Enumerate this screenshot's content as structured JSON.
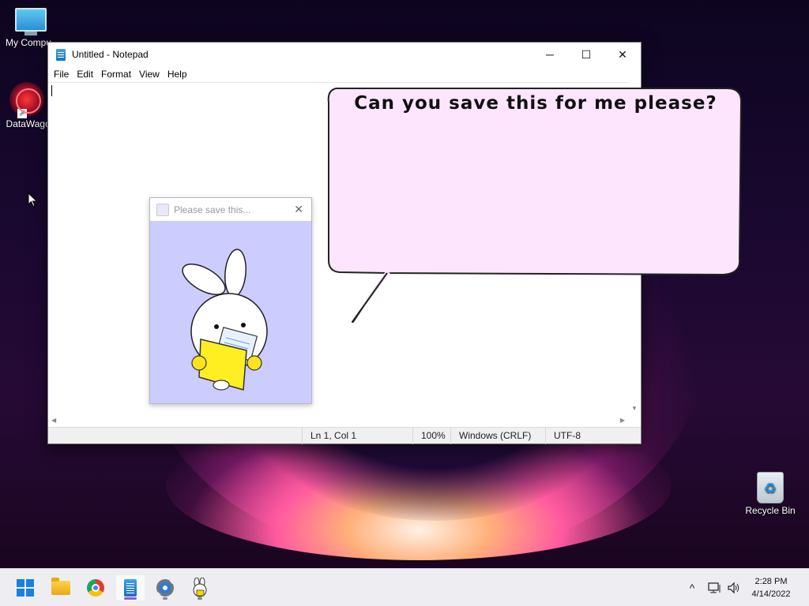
{
  "desktop": {
    "icons": [
      {
        "label": "My Compu",
        "icon": "monitor-icon"
      },
      {
        "label": "DataWagon",
        "icon": "datawagon-icon"
      },
      {
        "label": "Recycle Bin",
        "icon": "recycle-bin-icon"
      }
    ]
  },
  "notepad": {
    "title": "Untitled - Notepad",
    "controls": {
      "minimize": "─",
      "maximize": "☐",
      "close": "✕"
    },
    "menu": [
      "File",
      "Edit",
      "Format",
      "View",
      "Help"
    ],
    "content": "",
    "status": {
      "position": "Ln 1, Col 1",
      "zoom": "100%",
      "line_endings": "Windows (CRLF)",
      "encoding": "UTF-8"
    }
  },
  "popup": {
    "title": "Please save this...",
    "close": "✕",
    "background": "#ccccff",
    "illustration": "bunny-holding-folder"
  },
  "bubble": {
    "text": "Can you save this for me please?",
    "fill": "#fde6fd"
  },
  "taskbar": {
    "apps": [
      "start-button",
      "file-explorer-icon",
      "chrome-icon",
      "notepad-icon",
      "settings-icon",
      "bunny-app-icon"
    ],
    "active_app": "notepad-icon",
    "tray": {
      "chevron": "^"
    },
    "clock": {
      "time": "2:28 PM",
      "date": "4/14/2022"
    }
  }
}
